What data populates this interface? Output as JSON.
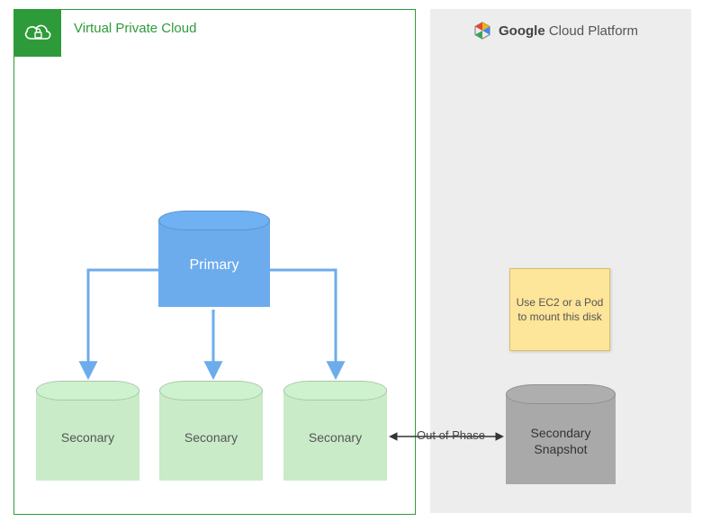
{
  "vpc": {
    "title": "Virtual Private Cloud"
  },
  "gcp": {
    "brand_strong": "Google",
    "brand_rest": "Cloud Platform"
  },
  "sticky": {
    "text": "Use EC2 or a Pod to mount this disk"
  },
  "nodes": {
    "primary": "Primary",
    "secondary1": "Seconary",
    "secondary2": "Seconary",
    "secondary3": "Seconary",
    "snapshot": "Secondary Snapshot"
  },
  "edges": {
    "out_of_phase": "Out of Phase"
  },
  "colors": {
    "vpc_green": "#2e9b3a",
    "primary_blue": "#6cacec",
    "secondary_green": "#c9ebc8",
    "snapshot_gray": "#a9a9a9",
    "sticky_yellow": "#fde599",
    "gcp_panel": "#ededed"
  }
}
